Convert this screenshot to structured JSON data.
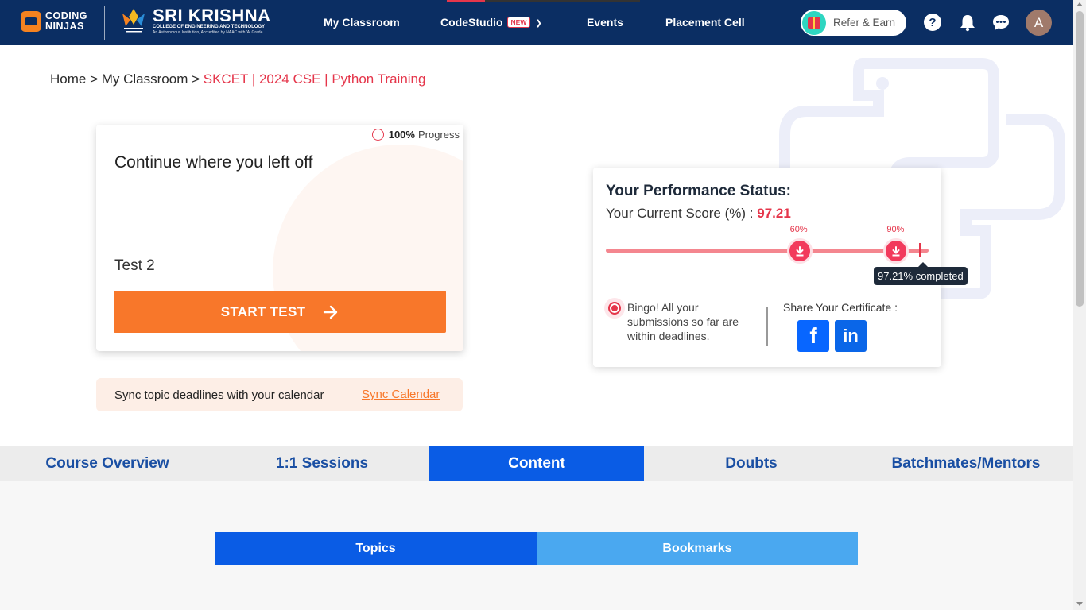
{
  "header": {
    "brand_line1": "CODING",
    "brand_line2": "NINJAS",
    "college_title": "SRI KRISHNA",
    "college_subtitle": "COLLEGE OF ENGINEERING AND TECHNOLOGY",
    "college_tagline": "An Autonomous Institution, Accredited by NAAC with 'A' Grade",
    "nav": [
      {
        "label": "My Classroom"
      },
      {
        "label": "CodeStudio",
        "badge": "NEW"
      },
      {
        "label": "Events"
      },
      {
        "label": "Placement Cell"
      }
    ],
    "refer_label": "Refer & Earn",
    "help_glyph": "?",
    "avatar_initial": "A"
  },
  "breadcrumb": {
    "home": "Home",
    "sep": " > ",
    "classroom": "My Classroom",
    "current": "SKCET | 2024 CSE | Python Training"
  },
  "continue_card": {
    "progress_value": "100%",
    "progress_label": "Progress",
    "title": "Continue where you left off",
    "test_name": "Test 2",
    "button_label": "START TEST"
  },
  "sync": {
    "text": "Sync topic deadlines with your calendar",
    "link": "Sync Calendar"
  },
  "performance": {
    "title": "Your Performance Status:",
    "score_label": "Your Current Score (%) :",
    "score_value": "97.21",
    "score_fraction": 0.9721,
    "milestones": [
      {
        "label": "60%",
        "fraction": 0.6
      },
      {
        "label": "90%",
        "fraction": 0.9
      }
    ],
    "tooltip": "97.21% completed",
    "bingo_text": "Bingo! All your submissions so far are within deadlines.",
    "share_label": "Share Your Certificate :",
    "facebook_glyph": "f",
    "linkedin_glyph": "in"
  },
  "tabs": [
    {
      "label": "Course Overview",
      "active": false
    },
    {
      "label": "1:1 Sessions",
      "active": false
    },
    {
      "label": "Content",
      "active": true
    },
    {
      "label": "Doubts",
      "active": false
    },
    {
      "label": "Batchmates/Mentors",
      "active": false
    }
  ],
  "subtabs": {
    "topics": "Topics",
    "bookmarks": "Bookmarks"
  },
  "colors": {
    "nav_bg": "#0b2e63",
    "accent_red": "#e5364b",
    "accent_orange": "#f8772a",
    "tab_active": "#0a5ce5"
  }
}
